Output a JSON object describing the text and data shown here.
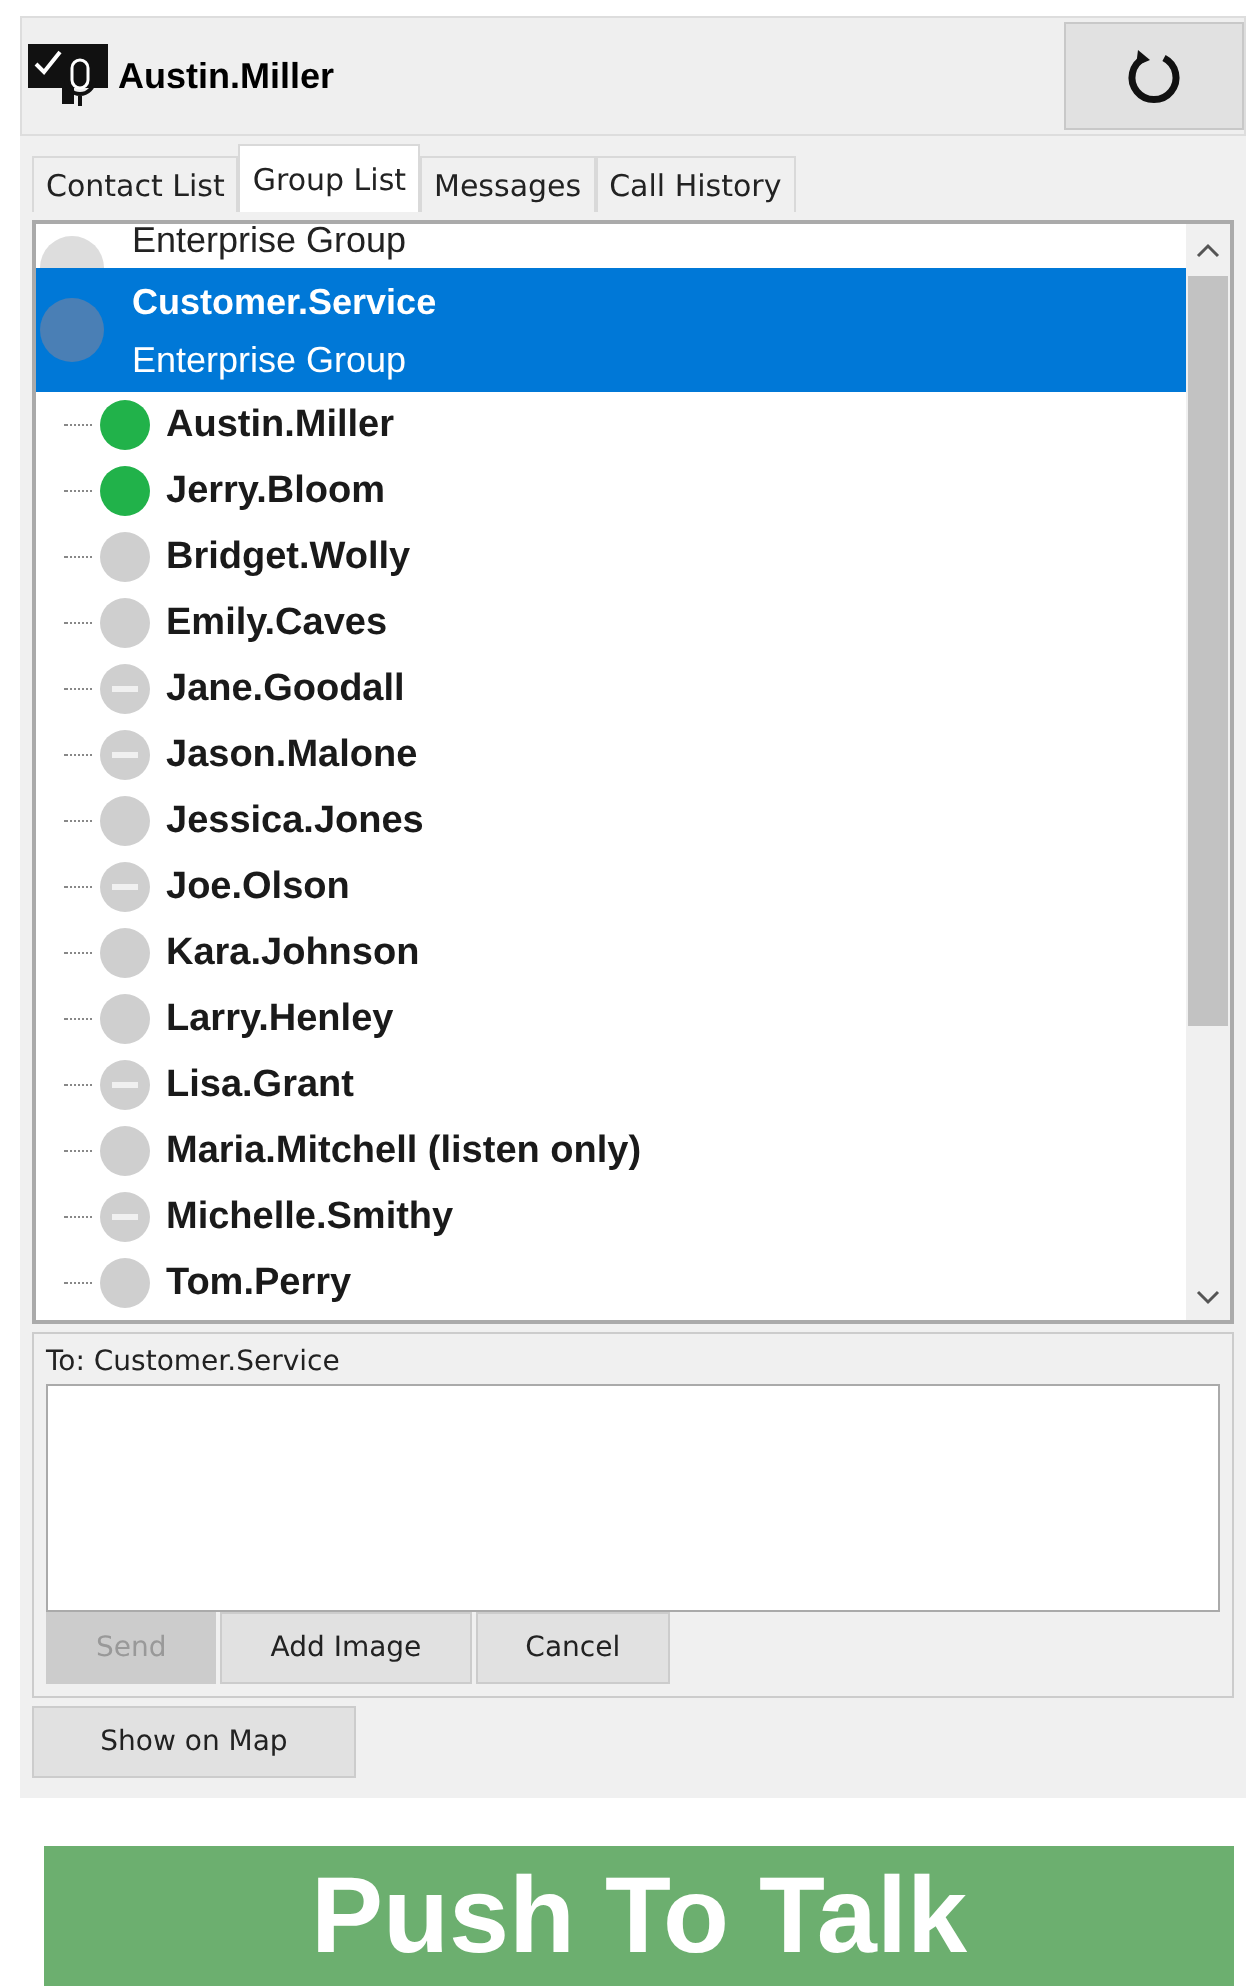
{
  "header": {
    "user": "Austin.Miller"
  },
  "tabs": [
    {
      "label": "Contact List",
      "selected": false
    },
    {
      "label": "Group List",
      "selected": true
    },
    {
      "label": "Messages",
      "selected": false
    },
    {
      "label": "Call History",
      "selected": false
    }
  ],
  "groups": [
    {
      "subtitle": "Enterprise Group",
      "selected": false,
      "cut": true
    },
    {
      "name": "Customer.Service",
      "subtitle": "Enterprise Group",
      "selected": true,
      "expanded": true,
      "children": [
        {
          "name": "Austin.Miller",
          "kind": "online"
        },
        {
          "name": "Jerry.Bloom",
          "kind": "online"
        },
        {
          "name": "Bridget.Wolly",
          "kind": "offline"
        },
        {
          "name": "Emily.Caves",
          "kind": "offline"
        },
        {
          "name": "Jane.Goodall",
          "kind": "busy"
        },
        {
          "name": "Jason.Malone",
          "kind": "busy"
        },
        {
          "name": "Jessica.Jones",
          "kind": "offline"
        },
        {
          "name": "Joe.Olson",
          "kind": "busy"
        },
        {
          "name": "Kara.Johnson",
          "kind": "offline"
        },
        {
          "name": "Larry.Henley",
          "kind": "offline"
        },
        {
          "name": "Lisa.Grant",
          "kind": "busy"
        },
        {
          "name": "Maria.Mitchell (listen only)",
          "kind": "offline"
        },
        {
          "name": "Michelle.Smithy",
          "kind": "busy"
        },
        {
          "name": "Tom.Perry",
          "kind": "offline"
        }
      ]
    }
  ],
  "message": {
    "to": "To: Customer.Service",
    "buttons": [
      {
        "label": "Send",
        "disabled": true
      },
      {
        "label": "Add Image",
        "disabled": false
      },
      {
        "label": "Cancel",
        "disabled": false
      }
    ]
  },
  "map_button": "Show on Map",
  "push_to_talk": "Push To Talk"
}
